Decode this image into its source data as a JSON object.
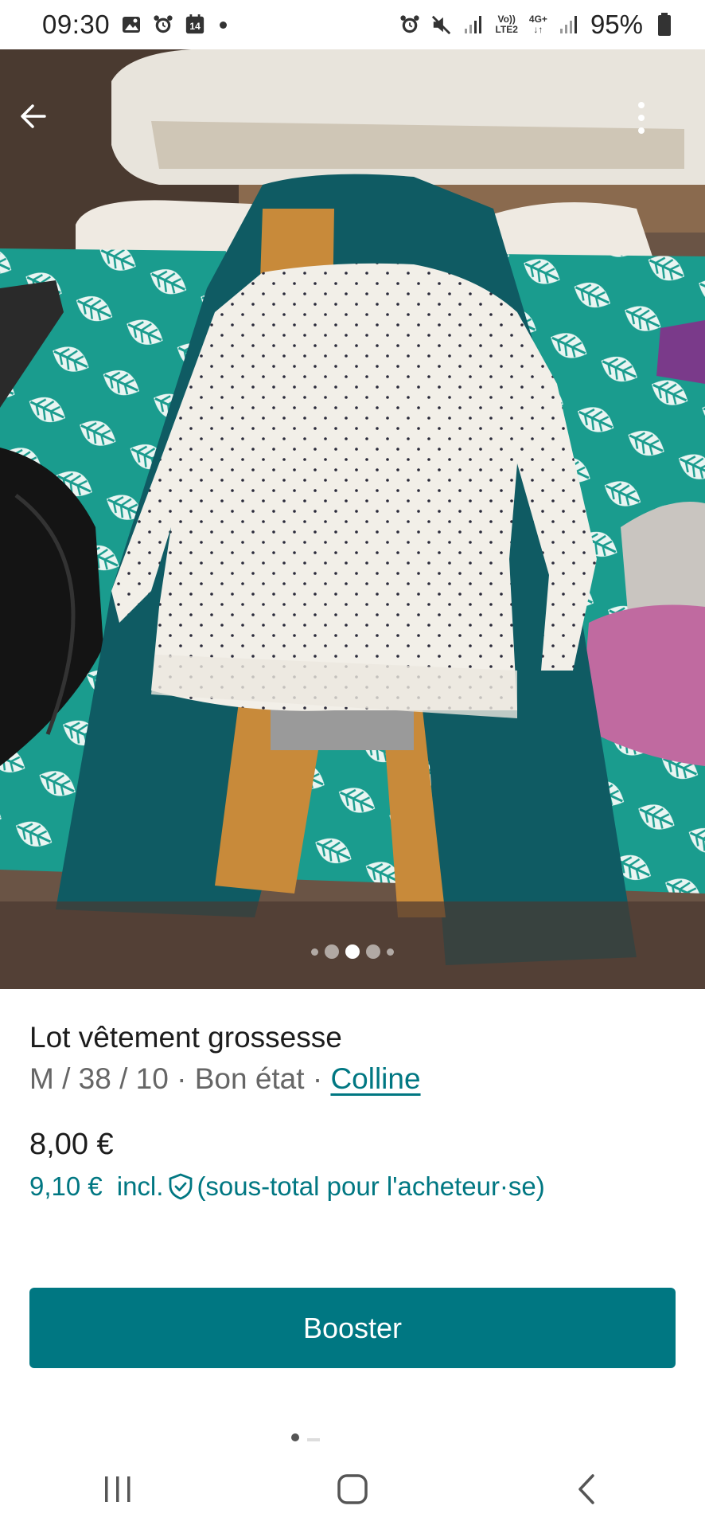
{
  "status_bar": {
    "time": "09:30",
    "battery": "95%",
    "network_top": "Vo))",
    "network_bottom": "LTE2",
    "data_type": "4G+",
    "calendar_day": "14",
    "icons_left": [
      "image-icon",
      "alarm-icon",
      "calendar-icon",
      "dot-icon"
    ],
    "icons_right": [
      "alarm-icon",
      "mute-icon",
      "signal-icon",
      "volte-icon",
      "data-icon",
      "signal-icon",
      "battery-icon"
    ]
  },
  "photo": {
    "description_icons": [
      "back-arrow-icon",
      "more-vertical-icon"
    ],
    "pager": {
      "total": 5,
      "active_index": 2
    }
  },
  "item": {
    "title": "Lot vêtement grossesse",
    "size": "M / 38 / 10",
    "separator": " · ",
    "condition": "Bon état",
    "brand": "Colline",
    "price": "8,00 €",
    "buyer_price": "9,10 €",
    "buyer_price_incl": "incl.",
    "buyer_price_note": "(sous-total pour l'acheteur·se)"
  },
  "actions": {
    "booster_label": "Booster"
  },
  "colors": {
    "accent": "#007782",
    "text": "#1c1c1c",
    "muted": "#666666"
  },
  "nav": {
    "icons": [
      "recent-apps-icon",
      "home-icon",
      "back-icon"
    ]
  }
}
